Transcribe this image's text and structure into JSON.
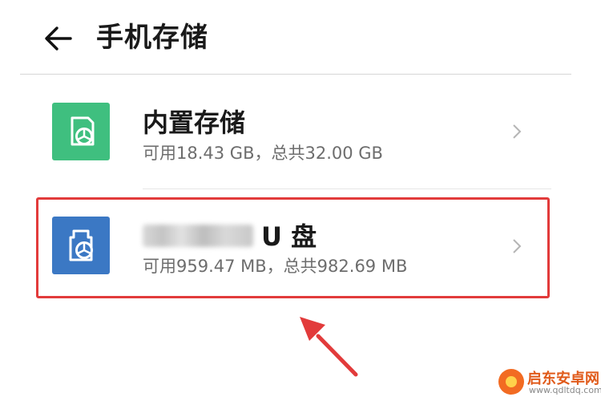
{
  "header": {
    "back_icon": "arrow-left-icon",
    "title": "手机存储"
  },
  "storage_items": [
    {
      "icon": "internal-storage-icon",
      "icon_color": "#3fbf7f",
      "title": "内置存储",
      "subtitle": "可用18.43 GB，总共32.00 GB"
    },
    {
      "icon": "usb-drive-icon",
      "icon_color": "#3b78c4",
      "title": "U 盘",
      "subtitle": "可用959.47 MB，总共982.69 MB"
    }
  ],
  "colors": {
    "highlight": "#e23b3b",
    "arrow": "#e23b3b"
  },
  "watermark": {
    "title": "启东安卓网",
    "url": "www.qdltdq.com"
  }
}
